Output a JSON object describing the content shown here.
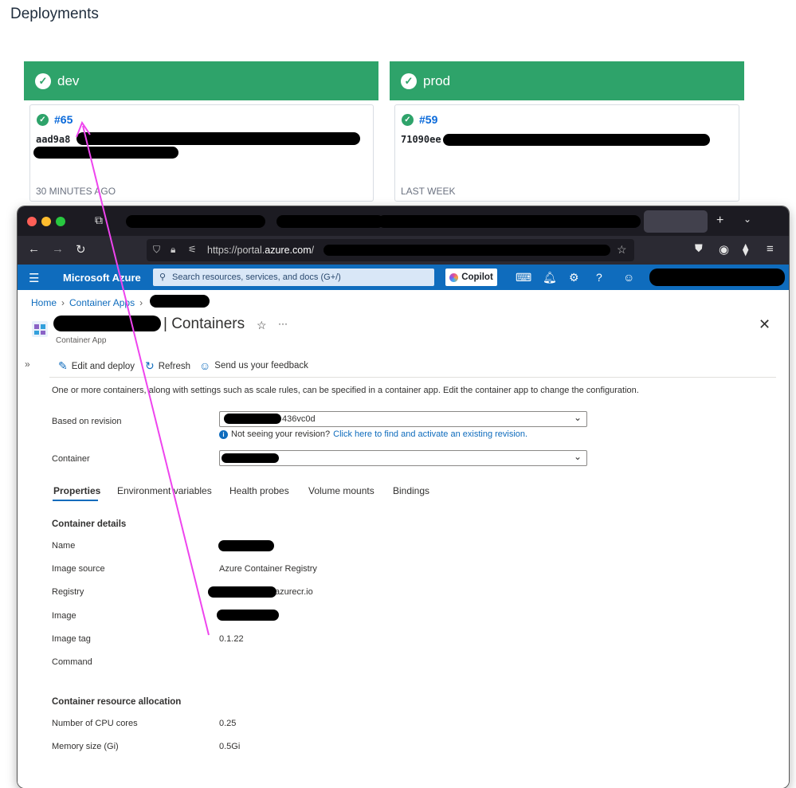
{
  "deployments": {
    "title": "Deployments",
    "environments": [
      {
        "name": "dev",
        "run": "#65",
        "sha": "aad9a8",
        "time": "30 MINUTES AGO",
        "status": "success"
      },
      {
        "name": "prod",
        "run": "#59",
        "sha": "71090ee",
        "time": "LAST WEEK",
        "status": "success"
      }
    ],
    "accent_color": "#2ea36a"
  },
  "browser": {
    "tab_icons": [
      "close-icon",
      "plus-icon",
      "chevron-down-icon"
    ],
    "url_prefix": "https://portal.",
    "url_domain": "azure.com",
    "url_suffix": "/"
  },
  "azure": {
    "brand": "Microsoft Azure",
    "search_placeholder": "Search resources, services, and docs (G+/)",
    "copilot_label": "Copilot",
    "brand_color": "#0f6cbd"
  },
  "page": {
    "breadcrumb": [
      "Home",
      "Container Apps"
    ],
    "title": "| Containers",
    "subtitle": "Container App",
    "commands": {
      "edit": "Edit and deploy",
      "refresh": "Refresh",
      "feedback": "Send us your feedback"
    },
    "description": "One or more containers, along with settings such as scale rules, can be specified in a container app. Edit the container app to change the configuration.",
    "revision_label": "Based on revision",
    "revision_value": "436vc0d",
    "revision_info": "Not seeing your revision?",
    "revision_link": "Click here to find and activate an existing revision.",
    "container_label": "Container",
    "tabs": [
      "Properties",
      "Environment variables",
      "Health probes",
      "Volume mounts",
      "Bindings"
    ],
    "container_details": {
      "heading": "Container details",
      "name_label": "Name",
      "image_source_label": "Image source",
      "image_source_value": "Azure Container Registry",
      "registry_label": "Registry",
      "registry_value": "azurecr.io",
      "image_label": "Image",
      "image_tag_label": "Image tag",
      "image_tag_value": "0.1.22",
      "command_label": "Command"
    },
    "resources": {
      "heading": "Container resource allocation",
      "cpu_label": "Number of CPU cores",
      "cpu_value": "0.25",
      "memory_label": "Memory size (Gi)",
      "memory_value": "0.5Gi"
    }
  },
  "annotation_color": "#ee44ee"
}
